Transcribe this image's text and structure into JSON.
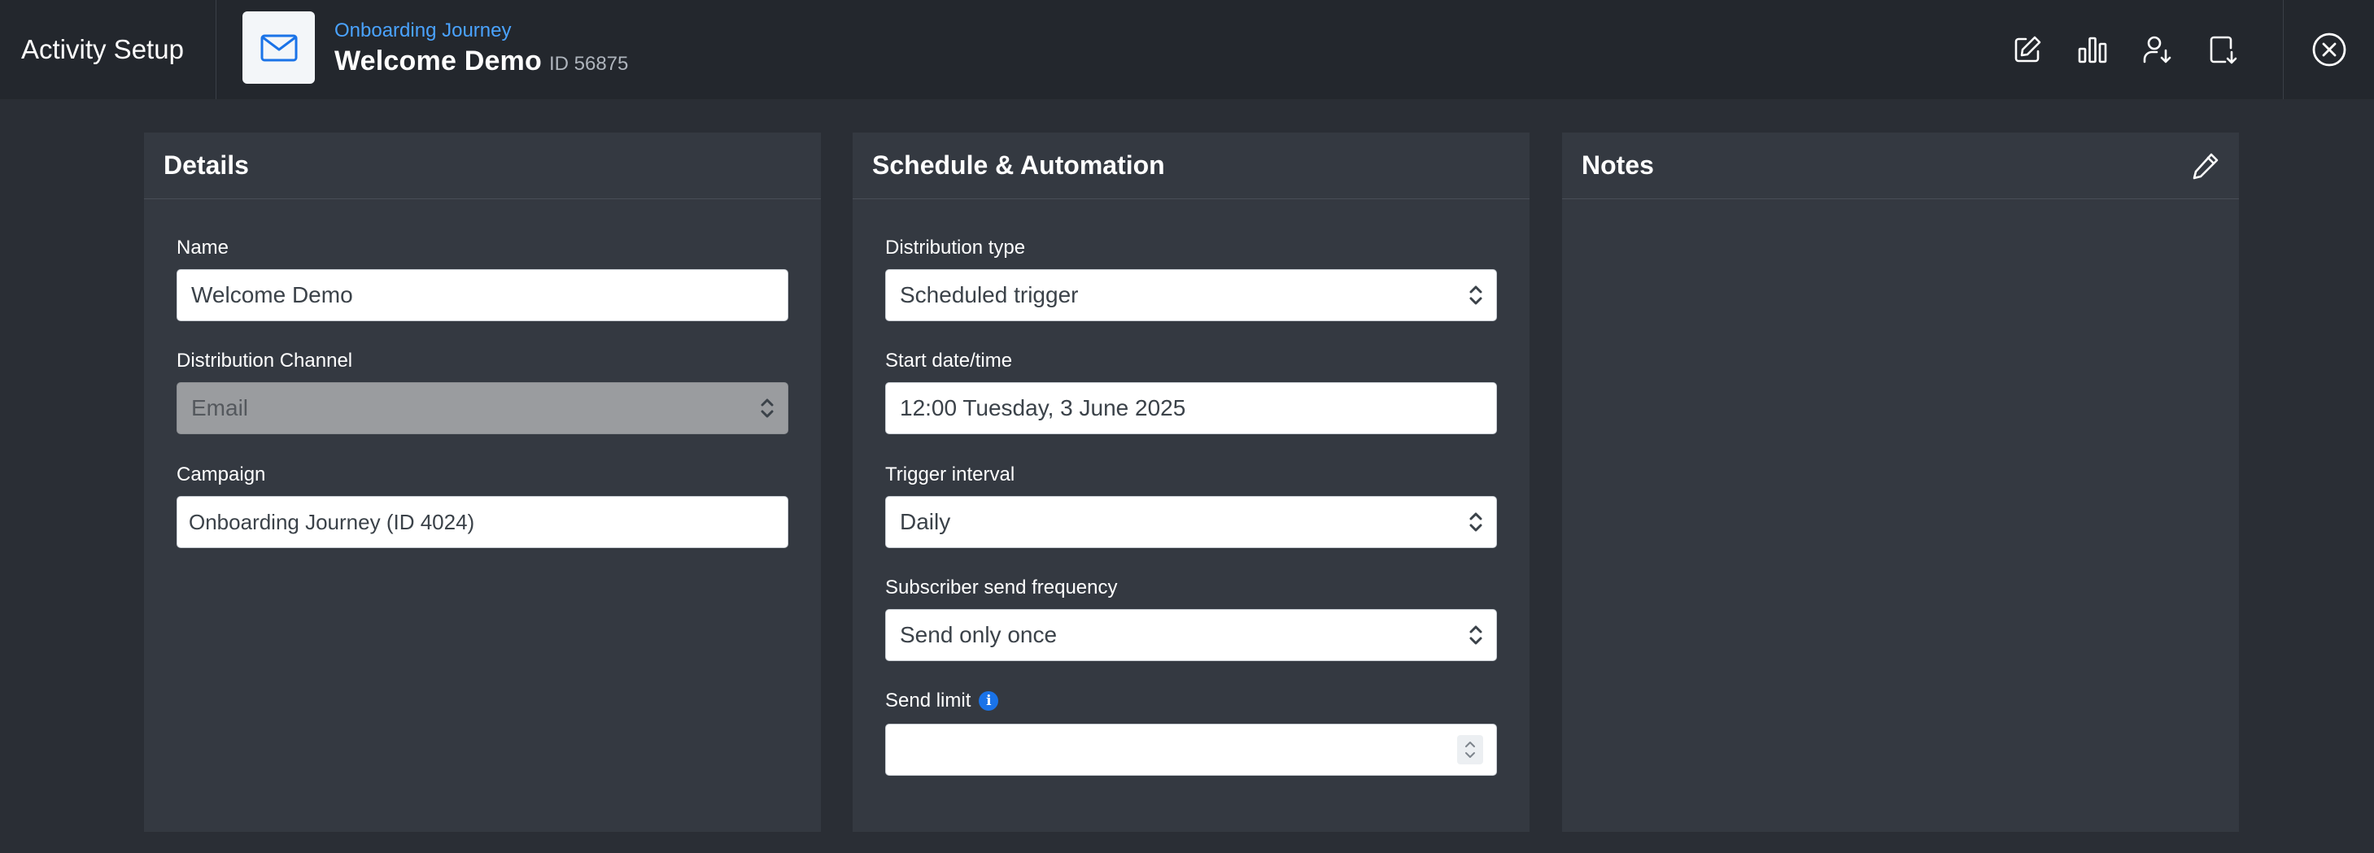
{
  "header": {
    "app_title": "Activity Setup",
    "breadcrumb": "Onboarding Journey",
    "activity_name": "Welcome Demo",
    "activity_id": "ID 56875"
  },
  "panels": {
    "details": {
      "title": "Details",
      "name_label": "Name",
      "name_value": "Welcome Demo",
      "channel_label": "Distribution Channel",
      "channel_value": "Email",
      "campaign_label": "Campaign",
      "campaign_value": "Onboarding Journey (ID 4024)"
    },
    "schedule": {
      "title": "Schedule & Automation",
      "distribution_type_label": "Distribution type",
      "distribution_type_value": "Scheduled trigger",
      "start_label": "Start date/time",
      "start_value": "12:00 Tuesday, 3 June 2025",
      "interval_label": "Trigger interval",
      "interval_value": "Daily",
      "frequency_label": "Subscriber send frequency",
      "frequency_value": "Send only once",
      "send_limit_label": "Send limit",
      "send_limit_value": "",
      "info_glyph": "i"
    },
    "notes": {
      "title": "Notes"
    }
  },
  "colors": {
    "header_bg": "#23272d",
    "page_bg": "#2a2e35",
    "panel_bg": "#343941",
    "accent_link": "#4aa3ff",
    "info_blue": "#1a73e8"
  },
  "icons": {
    "activity": "envelope-icon",
    "toolbar": [
      "edit-icon",
      "bar-chart-icon",
      "user-download-icon",
      "file-download-icon"
    ],
    "close": "close-circle-icon",
    "notes_edit": "pencil-icon"
  }
}
